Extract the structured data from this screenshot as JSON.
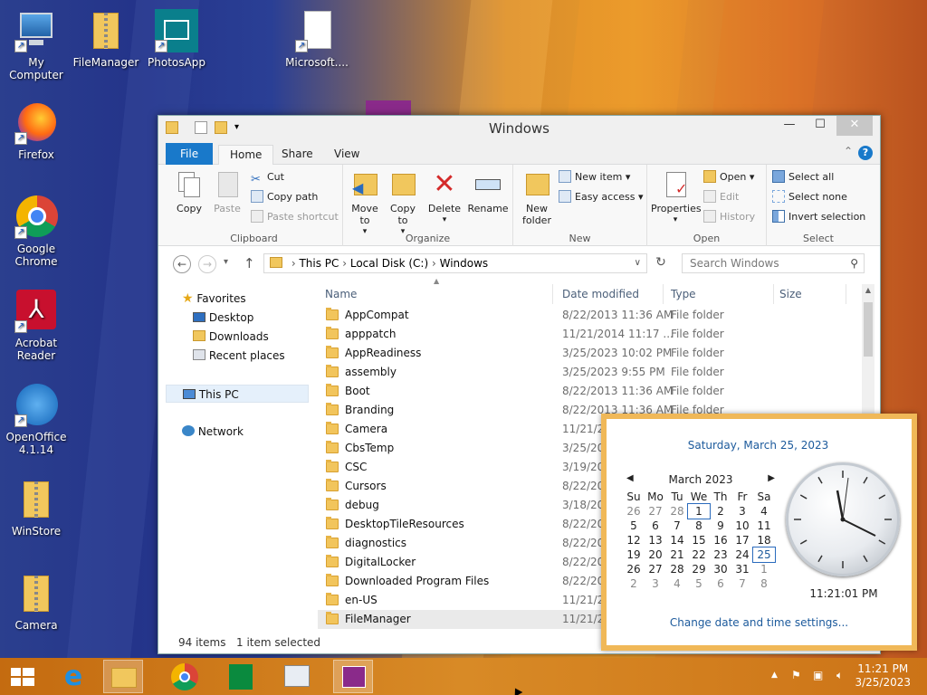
{
  "desktop": {
    "icons": [
      {
        "label": "My Computer"
      },
      {
        "label": "FileManager"
      },
      {
        "label": "PhotosApp"
      },
      {
        "label": "Microsoft...."
      },
      {
        "label": "Firefox"
      },
      {
        "label": "Google Chrome"
      },
      {
        "label": "Acrobat Reader"
      },
      {
        "label": "OpenOffice 4.1.14"
      },
      {
        "label": "WinStore"
      },
      {
        "label": "Camera"
      }
    ]
  },
  "window": {
    "title": "Windows",
    "tabs": {
      "file": "File",
      "home": "Home",
      "share": "Share",
      "view": "View"
    },
    "ribbon": {
      "clipboard": {
        "label": "Clipboard",
        "copy": "Copy",
        "paste": "Paste",
        "cut": "Cut",
        "copy_path": "Copy path",
        "paste_shortcut": "Paste shortcut"
      },
      "organize": {
        "label": "Organize",
        "move_to": "Move to",
        "copy_to": "Copy to",
        "delete": "Delete",
        "rename": "Rename"
      },
      "new": {
        "label": "New",
        "new_folder": "New folder",
        "new_item": "New item",
        "easy_access": "Easy access"
      },
      "open": {
        "label": "Open",
        "properties": "Properties",
        "open": "Open",
        "edit": "Edit",
        "history": "History"
      },
      "select": {
        "label": "Select",
        "select_all": "Select all",
        "select_none": "Select none",
        "invert_selection": "Invert selection"
      }
    },
    "address": {
      "crumbs": [
        "This PC",
        "Local Disk (C:)",
        "Windows"
      ],
      "search_placeholder": "Search Windows"
    },
    "nav": {
      "favorites": "Favorites",
      "desktop": "Desktop",
      "downloads": "Downloads",
      "recent": "Recent places",
      "this_pc": "This PC",
      "network": "Network"
    },
    "columns": {
      "name": "Name",
      "date": "Date modified",
      "type": "Type",
      "size": "Size"
    },
    "files": [
      {
        "name": "AppCompat",
        "date": "8/22/2013 11:36 AM",
        "type": "File folder"
      },
      {
        "name": "apppatch",
        "date": "11/21/2014 11:17 ...",
        "type": "File folder"
      },
      {
        "name": "AppReadiness",
        "date": "3/25/2023 10:02 PM",
        "type": "File folder"
      },
      {
        "name": "assembly",
        "date": "3/25/2023 9:55 PM",
        "type": "File folder"
      },
      {
        "name": "Boot",
        "date": "8/22/2013 11:36 AM",
        "type": "File folder"
      },
      {
        "name": "Branding",
        "date": "8/22/2013 11:36 AM",
        "type": "File folder"
      },
      {
        "name": "Camera",
        "date": "11/21/20",
        "type": ""
      },
      {
        "name": "CbsTemp",
        "date": "3/25/20",
        "type": ""
      },
      {
        "name": "CSC",
        "date": "3/19/20",
        "type": ""
      },
      {
        "name": "Cursors",
        "date": "8/22/20",
        "type": ""
      },
      {
        "name": "debug",
        "date": "3/18/20",
        "type": ""
      },
      {
        "name": "DesktopTileResources",
        "date": "8/22/20",
        "type": ""
      },
      {
        "name": "diagnostics",
        "date": "8/22/20",
        "type": ""
      },
      {
        "name": "DigitalLocker",
        "date": "8/22/20",
        "type": ""
      },
      {
        "name": "Downloaded Program Files",
        "date": "8/22/20",
        "type": ""
      },
      {
        "name": "en-US",
        "date": "11/21/20",
        "type": ""
      },
      {
        "name": "FileManager",
        "date": "11/21/20",
        "type": ""
      }
    ],
    "status": {
      "count": "94 items",
      "selected": "1 item selected"
    }
  },
  "clock_popup": {
    "long_date": "Saturday, March 25, 2023",
    "month": "March 2023",
    "weekdays": [
      "Su",
      "Mo",
      "Tu",
      "We",
      "Th",
      "Fr",
      "Sa"
    ],
    "weeks": [
      [
        "26",
        "27",
        "28",
        "1",
        "2",
        "3",
        "4"
      ],
      [
        "5",
        "6",
        "7",
        "8",
        "9",
        "10",
        "11"
      ],
      [
        "12",
        "13",
        "14",
        "15",
        "16",
        "17",
        "18"
      ],
      [
        "19",
        "20",
        "21",
        "22",
        "23",
        "24",
        "25"
      ],
      [
        "26",
        "27",
        "28",
        "29",
        "30",
        "31",
        "1"
      ],
      [
        "2",
        "3",
        "4",
        "5",
        "6",
        "7",
        "8"
      ]
    ],
    "time": "11:21:01 PM",
    "change_link": "Change date and time settings..."
  },
  "taskbar": {
    "time": "11:21 PM",
    "date": "3/25/2023"
  },
  "colors": {
    "accent": "#1979ca",
    "taskbar": "#d07c1c",
    "popup_border": "#f0b858"
  }
}
